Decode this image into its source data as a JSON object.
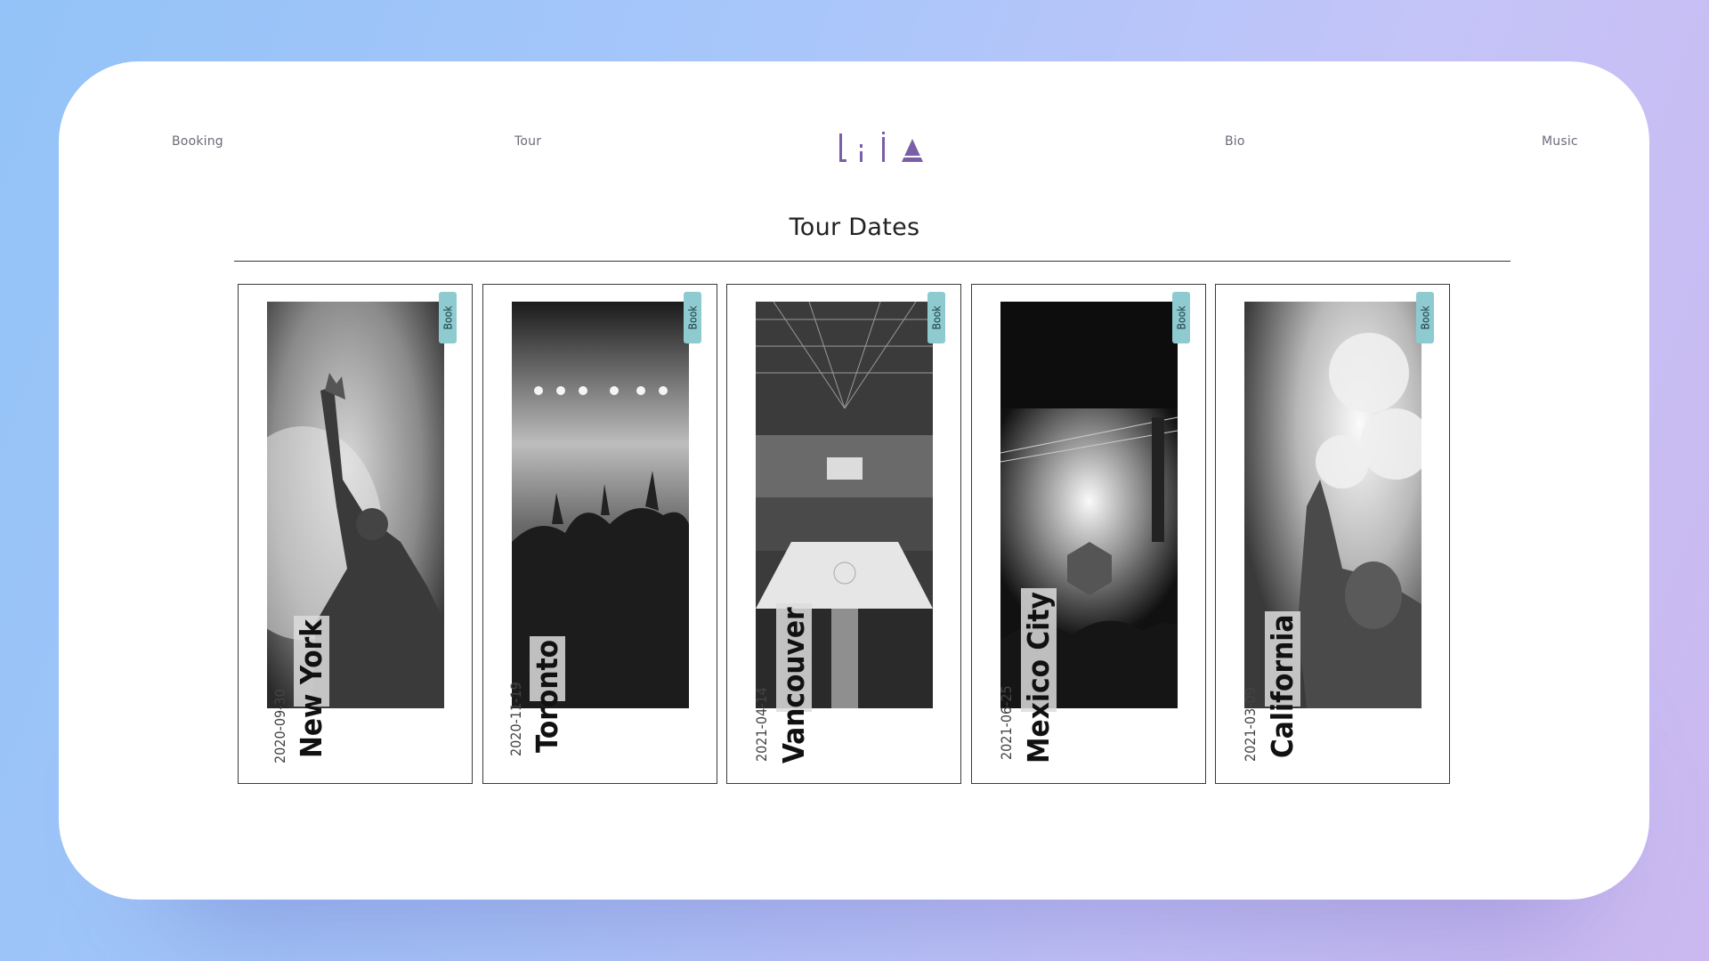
{
  "nav": {
    "left": [
      "Booking",
      "Tour"
    ],
    "right": [
      "Bio",
      "Music"
    ],
    "logo": "LiIA"
  },
  "page": {
    "title": "Tour Dates"
  },
  "tour": {
    "book_label": "Book",
    "cards": [
      {
        "city": "New York",
        "date": "2020-09-30"
      },
      {
        "city": "Toronto",
        "date": "2020-11-19"
      },
      {
        "city": "Vancouver",
        "date": "2021-04-14"
      },
      {
        "city": "Mexico City",
        "date": "2021-06-25"
      },
      {
        "city": "California",
        "date": "2021-03-09"
      }
    ]
  },
  "colors": {
    "accent": "#7a5ea8",
    "book_button": "#8ecbd1"
  }
}
